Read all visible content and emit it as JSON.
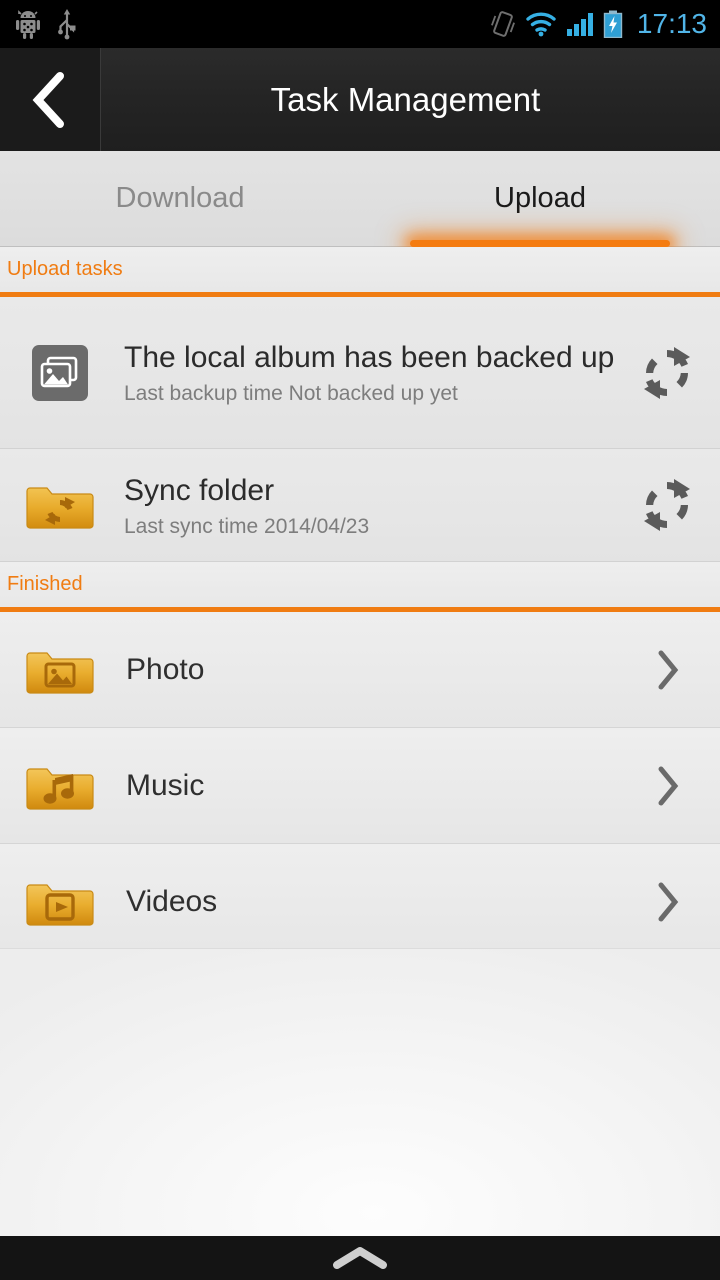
{
  "status_bar": {
    "time": "17:13",
    "icons": [
      "android-robot-icon",
      "usb-icon",
      "vibrate-icon",
      "wifi-icon",
      "cellular-signal-icon",
      "battery-charging-icon"
    ],
    "time_color": "#51b5e8",
    "background": "#000000"
  },
  "title_bar": {
    "title": "Task Management",
    "back_icon": "chevron-left-icon",
    "background": "#262626"
  },
  "tabs": [
    {
      "label": "Download",
      "active": false
    },
    {
      "label": "Upload",
      "active": true
    }
  ],
  "accent_color": "#f07c12",
  "sections": [
    {
      "header": "Upload tasks",
      "rows": [
        {
          "title": "The local album has been backed up",
          "subtitle": "Last backup time Not backed up yet",
          "icon": "gallery-image-icon",
          "icon_style": "gray-square",
          "action_icon": "sync-refresh-icon"
        },
        {
          "title": "Sync folder",
          "subtitle": "Last sync time 2014/04/23",
          "icon": "folder-sync-icon",
          "icon_style": "gold-folder",
          "action_icon": "sync-refresh-icon"
        }
      ]
    },
    {
      "header": "Finished",
      "rows": [
        {
          "title": "Photo",
          "icon": "folder-photo-icon",
          "action_icon": "chevron-right-icon"
        },
        {
          "title": "Music",
          "icon": "folder-music-icon",
          "action_icon": "chevron-right-icon"
        },
        {
          "title": "Videos",
          "icon": "folder-video-icon",
          "action_icon": "chevron-right-icon"
        }
      ]
    }
  ],
  "nav_bar": {
    "icon": "chevron-up-icon",
    "background": "#141414"
  }
}
